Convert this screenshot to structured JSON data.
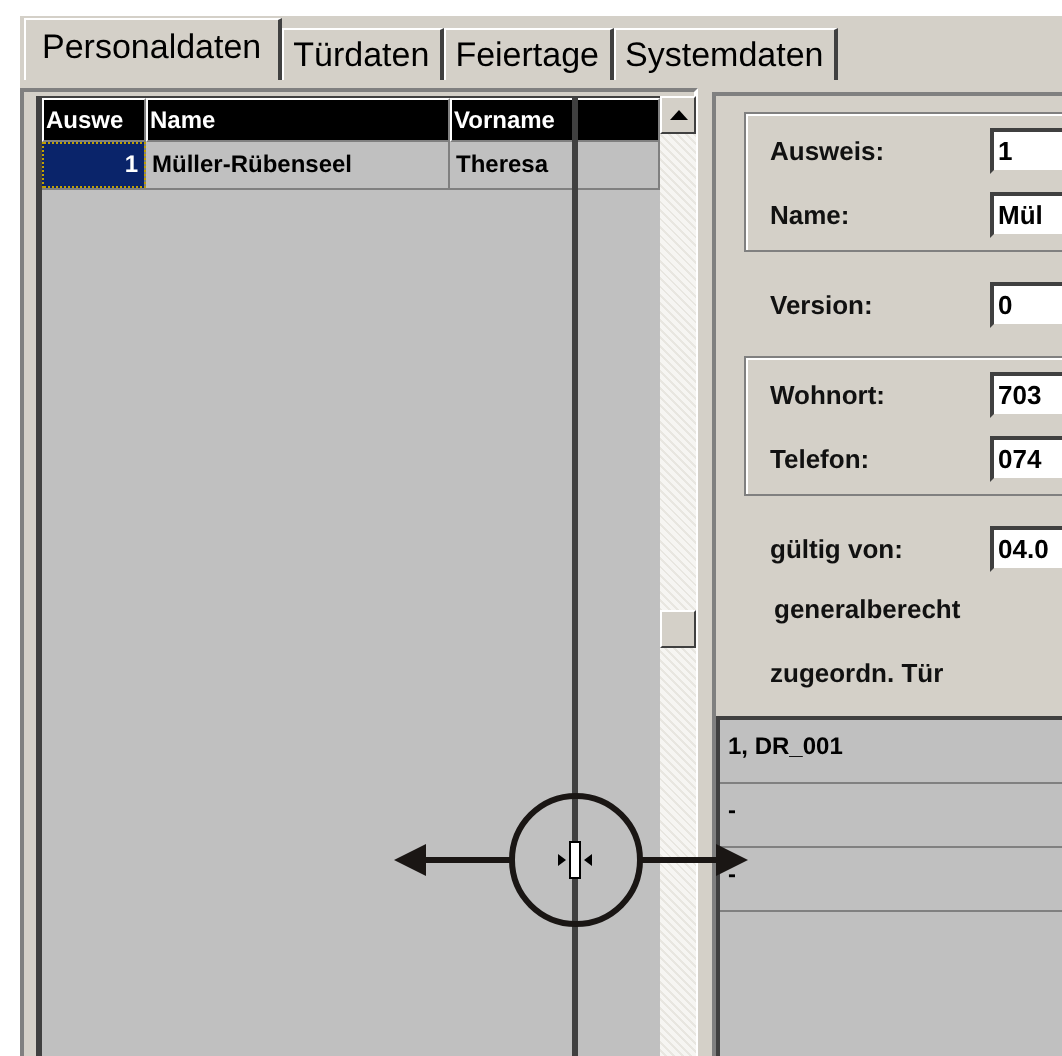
{
  "tabs": [
    {
      "label": "Personaldaten",
      "selected": true
    },
    {
      "label": "Türdaten",
      "selected": false
    },
    {
      "label": "Feiertage",
      "selected": false
    },
    {
      "label": "Systemdaten",
      "selected": false
    }
  ],
  "table": {
    "columns": [
      "Auswe",
      "Name",
      "Vorname"
    ],
    "rows": [
      {
        "cells": [
          "1",
          "Müller-Rübenseel",
          "Theresa"
        ],
        "selected": true
      }
    ]
  },
  "form": {
    "group_1": [
      {
        "label": "Ausweis:",
        "value": "1"
      },
      {
        "label": "Name:",
        "value": "Mül"
      }
    ],
    "version": {
      "label": "Version:",
      "value": "0"
    },
    "group_2": [
      {
        "label": "Wohnort:",
        "value": "703"
      },
      {
        "label": "Telefon:",
        "value": "074"
      }
    ],
    "valid_from": {
      "label": "gültig von:",
      "value": "04.0"
    },
    "general_label": "generalberecht",
    "doors_label": "zugeordn. Tür",
    "doors": [
      "1, DR_001",
      "-",
      "-"
    ]
  }
}
